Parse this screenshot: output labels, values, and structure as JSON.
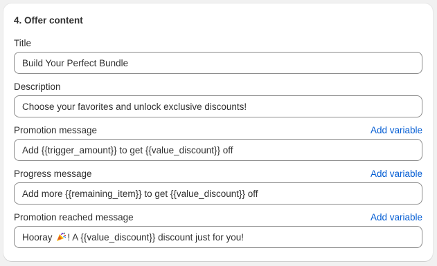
{
  "section": {
    "title": "4. Offer content"
  },
  "fields": [
    {
      "label": "Title",
      "value": "Build Your Perfect Bundle"
    },
    {
      "label": "Description",
      "value": "Choose your favorites and unlock exclusive discounts!"
    },
    {
      "label": "Promotion message",
      "value": "Add {{trigger_amount}} to get {{value_discount}} off",
      "action": "Add variable"
    },
    {
      "label": "Progress message",
      "value": "Add more {{remaining_item}} to get {{value_discount}} off",
      "action": "Add variable"
    },
    {
      "label": "Promotion reached message",
      "value_before": "Hooray",
      "emoji": "party-popper-emoji",
      "value_after": "! A {{value_discount}} discount just for you!",
      "action": "Add variable"
    }
  ],
  "colors": {
    "link": "#005bd3",
    "text": "#303030",
    "border": "#8a8a8a",
    "background": "#f1f1f1",
    "card": "#ffffff"
  }
}
